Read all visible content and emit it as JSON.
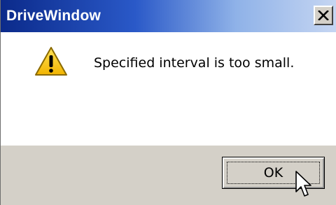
{
  "window": {
    "title": "DriveWindow",
    "close_label": "Close"
  },
  "message": {
    "text": "Specified interval is too small.",
    "icon": "warning-icon"
  },
  "buttons": {
    "ok_label": "OK"
  },
  "colors": {
    "titlebar_start": "#0b2a8a",
    "titlebar_end": "#c6d6f2",
    "footer_bg": "#d4d0c8",
    "warning_yellow": "#f2c200"
  }
}
